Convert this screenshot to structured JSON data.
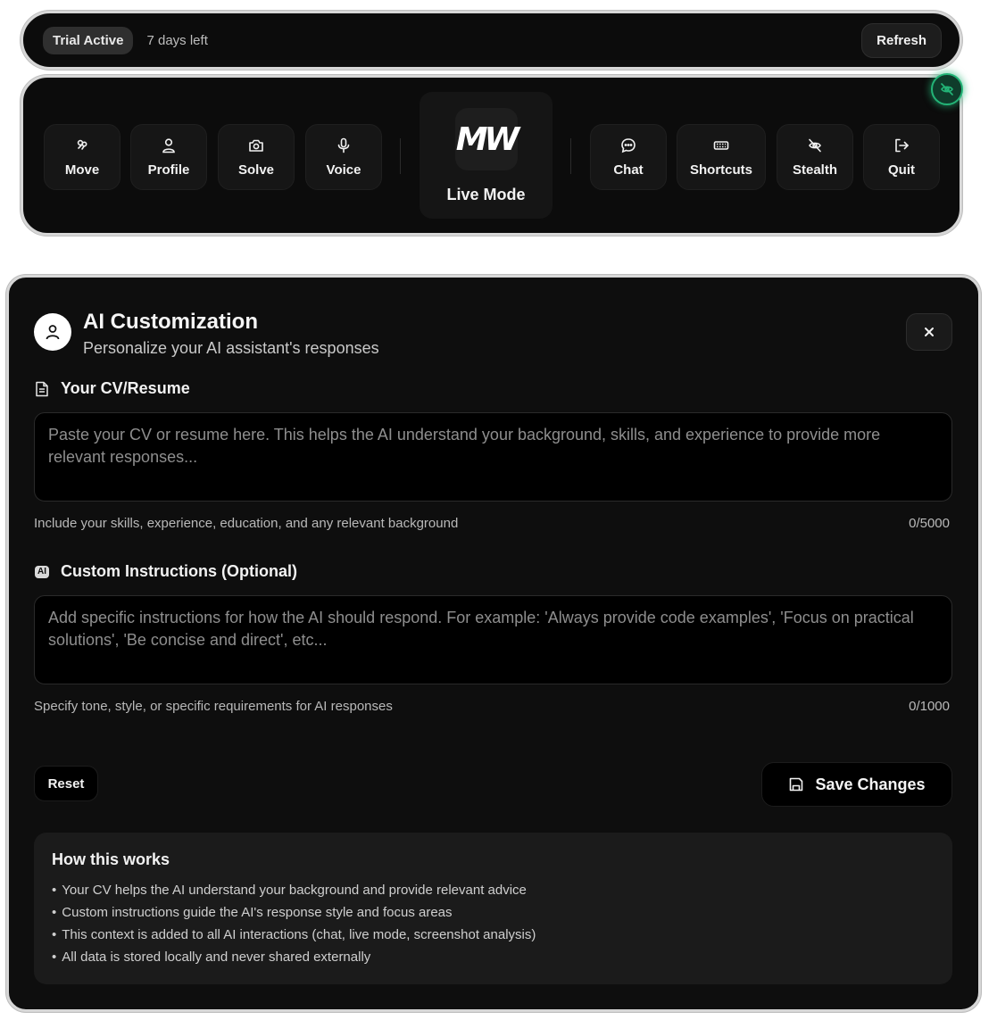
{
  "trial": {
    "badge": "Trial Active",
    "days_left": "7 days left",
    "refresh_label": "Refresh"
  },
  "toolbar": {
    "left_items": [
      {
        "label": "Move",
        "icon": "move-icon"
      },
      {
        "label": "Profile",
        "icon": "profile-icon"
      },
      {
        "label": "Solve",
        "icon": "camera-icon"
      },
      {
        "label": "Voice",
        "icon": "microphone-icon"
      }
    ],
    "live_mode": {
      "logo": "MW",
      "label": "Live Mode"
    },
    "right_items": [
      {
        "label": "Chat",
        "icon": "chat-icon"
      },
      {
        "label": "Shortcuts",
        "icon": "keyboard-icon"
      },
      {
        "label": "Stealth",
        "icon": "eye-off-icon"
      },
      {
        "label": "Quit",
        "icon": "logout-icon"
      }
    ],
    "stealth_indicator": {
      "icon": "eye-off-icon",
      "color": "#23b477"
    }
  },
  "panel": {
    "title": "AI Customization",
    "subtitle": "Personalize your AI assistant's responses",
    "close_icon": "close-icon",
    "cv": {
      "label": "Your CV/Resume",
      "icon": "document-icon",
      "value": "",
      "placeholder": "Paste your CV or resume here. This helps the AI understand your background, skills, and experience to provide more relevant responses...",
      "hint": "Include your skills, experience, education, and any relevant background",
      "counter": "0/5000"
    },
    "instructions": {
      "label": "Custom Instructions (Optional)",
      "icon_badge": "AI",
      "value": "",
      "placeholder": "Add specific instructions for how the AI should respond. For example: 'Always provide code examples', 'Focus on practical solutions', 'Be concise and direct', etc...",
      "hint": "Specify tone, style, or specific requirements for AI responses",
      "counter": "0/1000"
    },
    "reset_label": "Reset",
    "save_label": "Save Changes",
    "how": {
      "title": "How this works",
      "items": [
        "Your CV helps the AI understand your background and provide relevant advice",
        "Custom instructions guide the AI's response style and focus areas",
        "This context is added to all AI interactions (chat, live mode, screenshot analysis)",
        "All data is stored locally and never shared externally"
      ]
    }
  }
}
